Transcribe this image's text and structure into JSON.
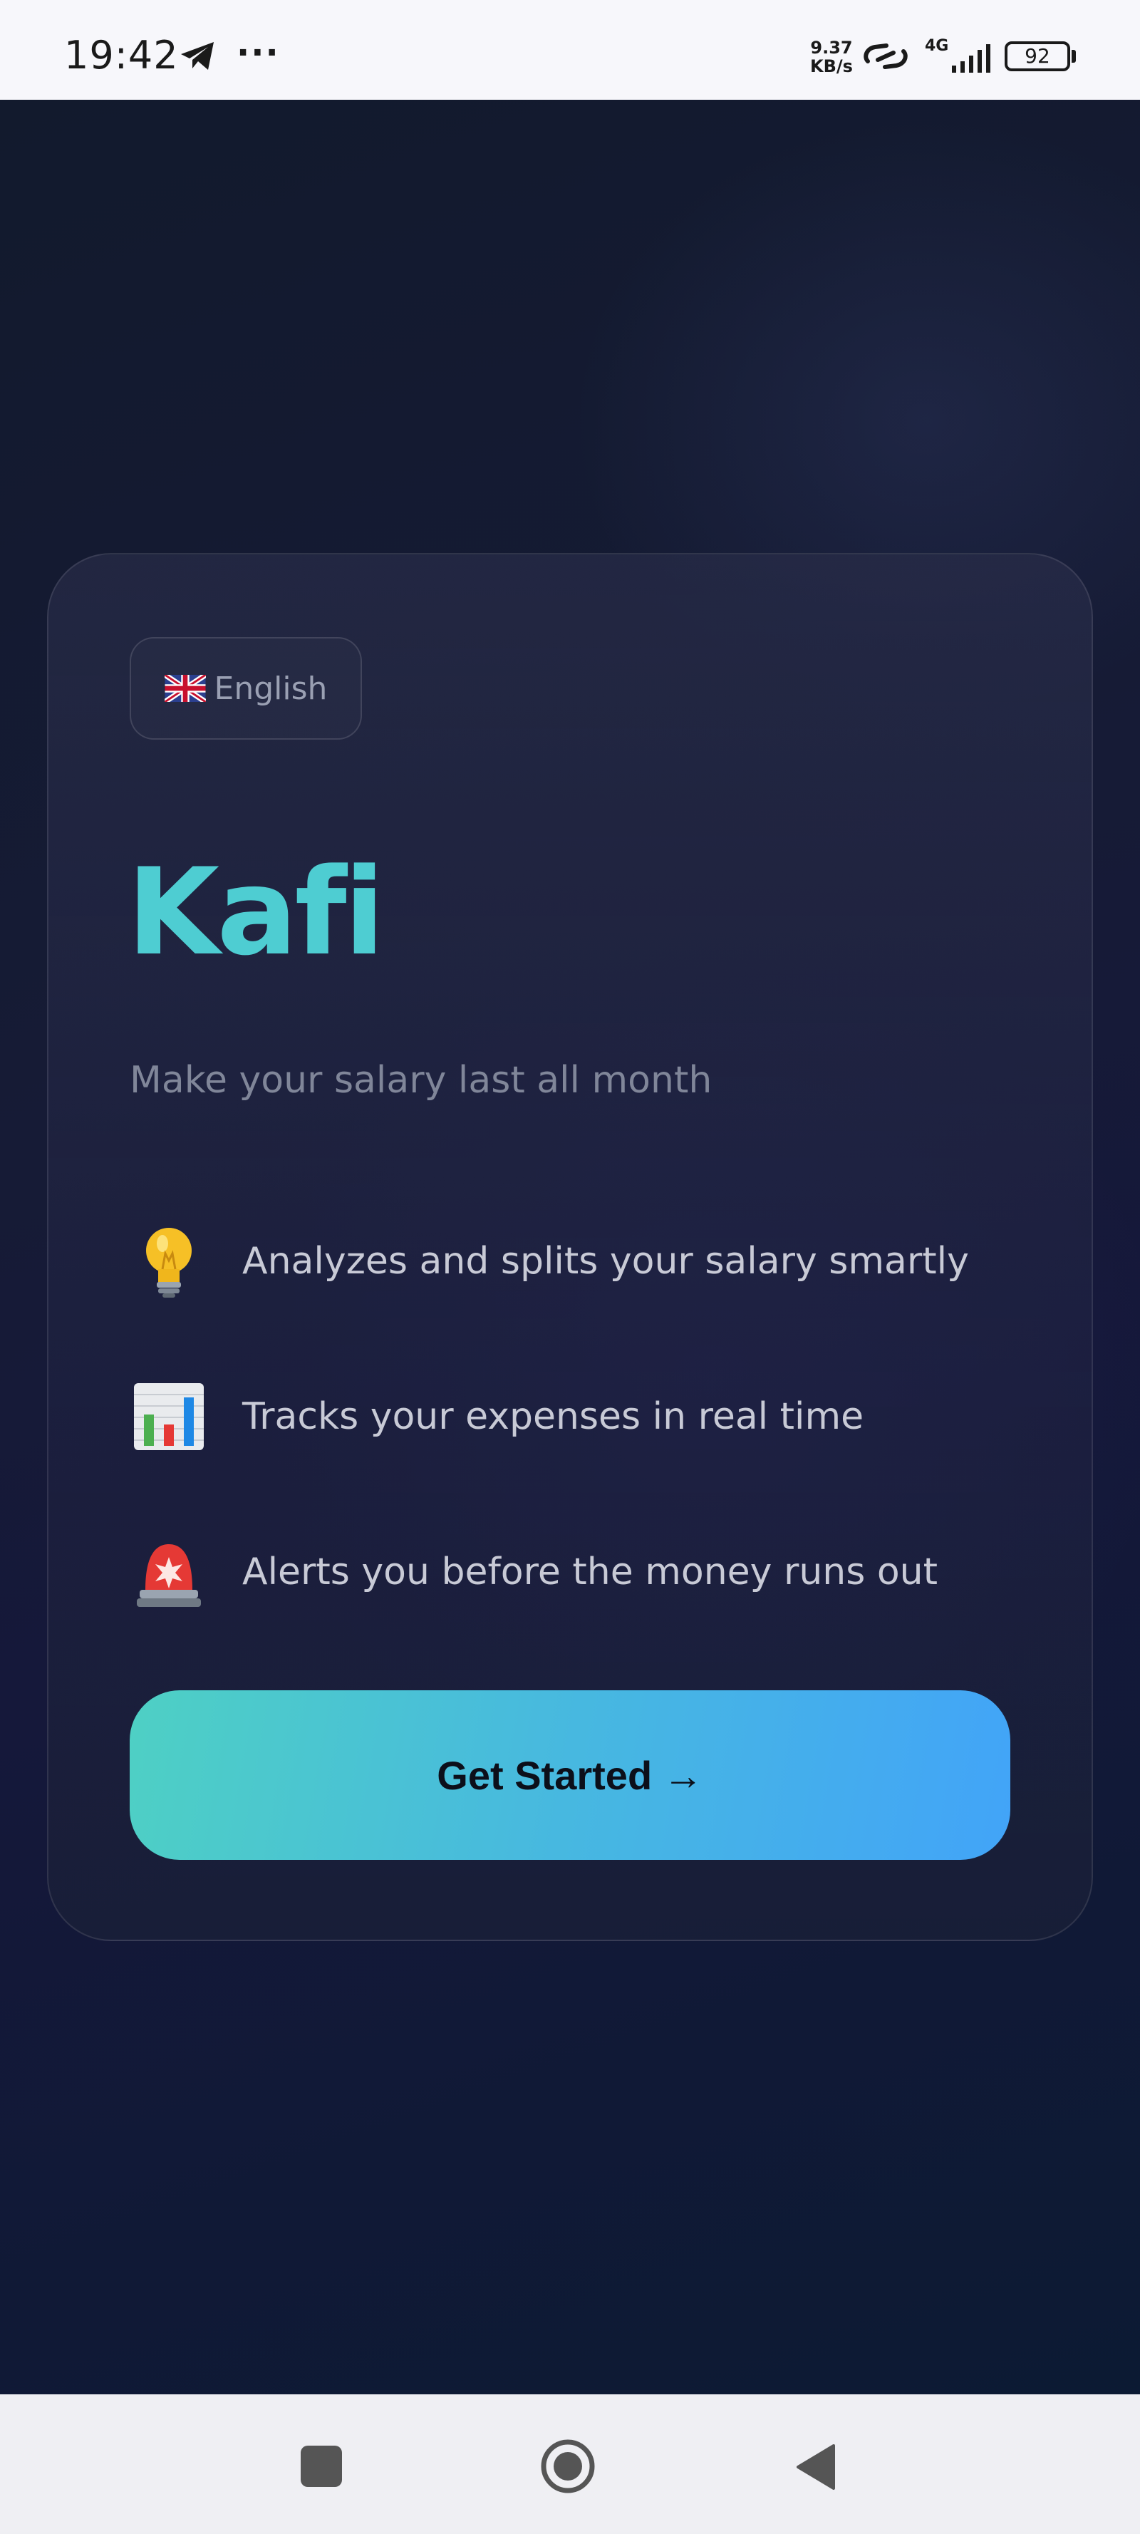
{
  "status_bar": {
    "time": "19:42",
    "more": "···",
    "net_speed_value": "9.37",
    "net_speed_unit": "KB/s",
    "network_type": "4G",
    "battery": "92"
  },
  "language_selector": {
    "flag": "uk-flag-icon",
    "label": "English"
  },
  "app": {
    "title": "Kafi",
    "tagline": "Make your salary last all month"
  },
  "features": [
    {
      "icon": "light-bulb-icon",
      "text": "Analyzes and splits your salary smartly"
    },
    {
      "icon": "bar-chart-icon",
      "text": "Tracks your expenses in real time"
    },
    {
      "icon": "siren-icon",
      "text": "Alerts you before the money runs out"
    }
  ],
  "cta": {
    "label": "Get Started →"
  },
  "colors": {
    "accent": "#4ecdd2",
    "button_gradient_start": "#4ed0c4",
    "button_gradient_end": "#42a4f8",
    "background": "#141a33"
  }
}
